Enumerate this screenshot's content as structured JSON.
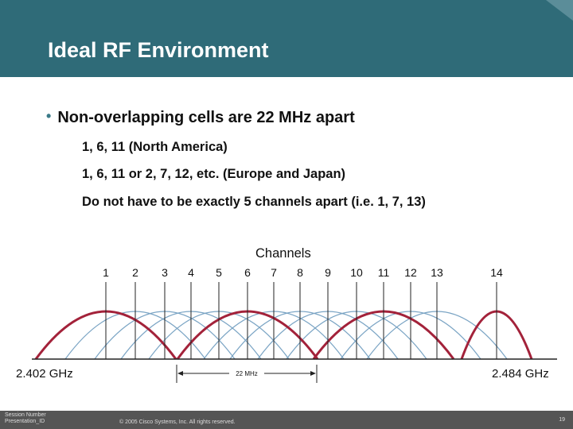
{
  "header": {
    "title": "Ideal RF Environment"
  },
  "bullet": {
    "main": "Non-overlapping cells are 22 MHz apart",
    "subs": [
      "1, 6, 11 (North America)",
      "1, 6, 11 or 2, 7, 12, etc. (Europe and Japan)",
      "Do not have to be exactly 5 channels apart (i.e. 1, 7, 13)"
    ]
  },
  "diagram": {
    "channels_title": "Channels",
    "channels": [
      "1",
      "2",
      "3",
      "4",
      "5",
      "6",
      "7",
      "8",
      "9",
      "10",
      "11",
      "12",
      "13",
      "14"
    ],
    "highlighted_channels": [
      "1",
      "6",
      "11",
      "14"
    ],
    "left_freq": "2.402 GHz",
    "right_freq": "2.484 GHz",
    "spacing_label": "22 MHz",
    "colors": {
      "highlight": "#a3223a",
      "normal": "#7aa4c4",
      "tick": "#222222"
    }
  },
  "footer": {
    "session_line1": "Session Number",
    "session_line2": "Presentation_ID",
    "copyright": "© 2005 Cisco Systems, Inc. All rights reserved.",
    "page": "19"
  }
}
